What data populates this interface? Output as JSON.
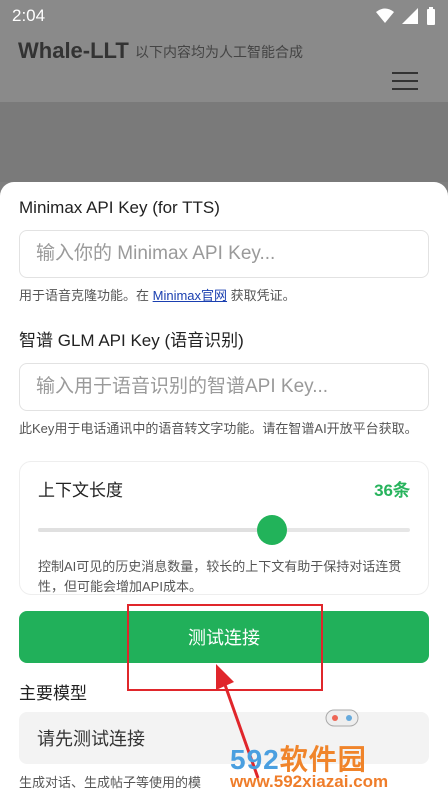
{
  "status": {
    "time": "2:04"
  },
  "appbar": {
    "title": "Whale-LLT",
    "subtitle": "以下内容均为人工智能合成"
  },
  "minimax": {
    "label": "Minimax API Key (for TTS)",
    "placeholder": "输入你的 Minimax API Key...",
    "hint_before": "用于语音克隆功能。在 ",
    "hint_link": "Minimax官网",
    "hint_after": " 获取凭证。"
  },
  "glm": {
    "label": "智谱 GLM API Key (语音识别)",
    "placeholder": "输入用于语音识别的智谱API Key...",
    "hint": "此Key用于电话通讯中的语音转文字功能。请在智谱AI开放平台获取。"
  },
  "context": {
    "title": "上下文长度",
    "value": "36条",
    "slider_fraction": 0.63,
    "hint": "控制AI可见的历史消息数量，较长的上下文有助于保持对话连贯性，但可能会增加API成本。"
  },
  "test_button": {
    "label": "测试连接"
  },
  "model": {
    "label": "主要模型",
    "select_text": "请先测试连接",
    "hint": "生成对话、生成帖子等使用的模"
  },
  "watermark": {
    "brand_num": "592",
    "brand_text": "软件园",
    "url": "www.592xiazai.com"
  },
  "colors": {
    "accent": "#21b05a",
    "annotation": "#e0262b",
    "link": "#1a3fb0"
  }
}
